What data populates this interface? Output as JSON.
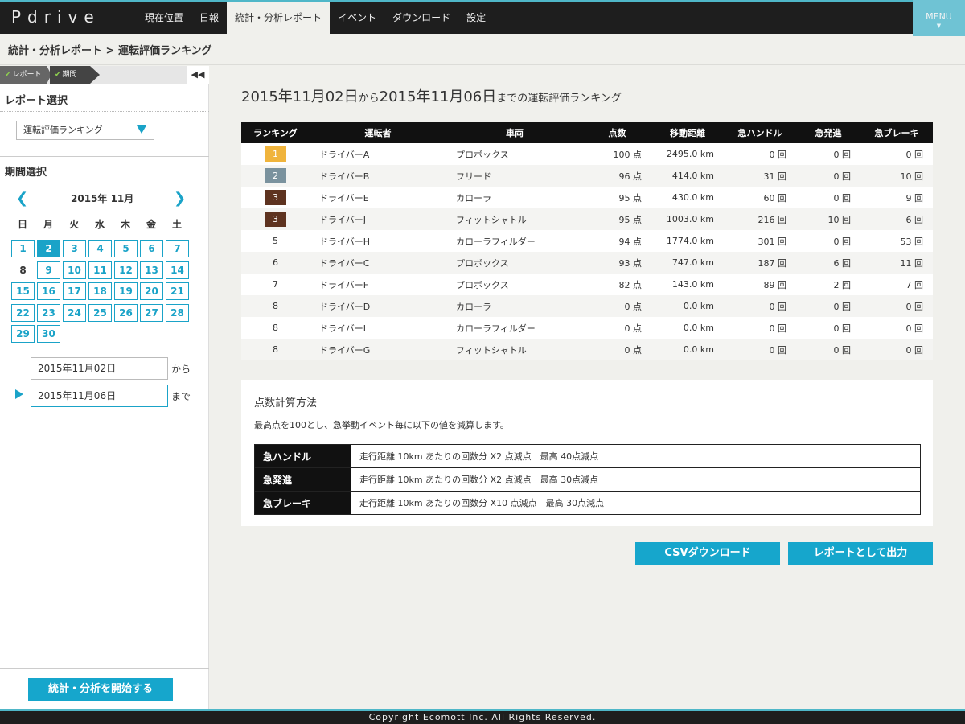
{
  "app": {
    "logo": "Pdrive",
    "menu_label": "MENU",
    "nav": [
      "現在位置",
      "日報",
      "統計・分析レポート",
      "イベント",
      "ダウンロード",
      "設定"
    ]
  },
  "breadcrumb": "統計・分析レポート > 運転評価ランキング",
  "sidebar": {
    "steps": [
      "レポート",
      "期間"
    ],
    "collapse_icon": "◀◀",
    "report_section_title": "レポート選択",
    "report_selected": "運転評価ランキング",
    "period_section_title": "期間選択",
    "calendar": {
      "title": "2015年 11月",
      "prev": "❮",
      "next": "❯",
      "weekdays": [
        "日",
        "月",
        "火",
        "水",
        "木",
        "金",
        "土"
      ],
      "selected_day": 2,
      "today_day": 8
    },
    "from_date": "2015年11月02日",
    "from_suffix": "から",
    "to_date": "2015年11月06日",
    "to_suffix": "まで",
    "start_button": "統計・分析を開始する"
  },
  "main": {
    "title_from": "2015年11月02日",
    "title_mid": "から",
    "title_to": "2015年11月06日",
    "title_end": "までの運転評価ランキング",
    "table": {
      "headers": [
        "ランキング",
        "運転者",
        "車両",
        "点数",
        "移動距離",
        "急ハンドル",
        "急発進",
        "急ブレーキ"
      ],
      "rows": [
        {
          "rank": "1",
          "driver": "ドライバーA",
          "car": "プロボックス",
          "score": "100 点",
          "distance": "2495.0 km",
          "handle": "0 回",
          "start": "0 回",
          "brake": "0 回"
        },
        {
          "rank": "2",
          "driver": "ドライバーB",
          "car": "フリード",
          "score": "96 点",
          "distance": "414.0 km",
          "handle": "31 回",
          "start": "0 回",
          "brake": "10 回"
        },
        {
          "rank": "3",
          "driver": "ドライバーE",
          "car": "カローラ",
          "score": "95 点",
          "distance": "430.0 km",
          "handle": "60 回",
          "start": "0 回",
          "brake": "9 回"
        },
        {
          "rank": "3",
          "driver": "ドライバーJ",
          "car": "フィットシャトル",
          "score": "95 点",
          "distance": "1003.0 km",
          "handle": "216 回",
          "start": "10 回",
          "brake": "6 回"
        },
        {
          "rank": "5",
          "driver": "ドライバーH",
          "car": "カローラフィルダー",
          "score": "94 点",
          "distance": "1774.0 km",
          "handle": "301 回",
          "start": "0 回",
          "brake": "53 回"
        },
        {
          "rank": "6",
          "driver": "ドライバーC",
          "car": "プロボックス",
          "score": "93 点",
          "distance": "747.0 km",
          "handle": "187 回",
          "start": "6 回",
          "brake": "11 回"
        },
        {
          "rank": "7",
          "driver": "ドライバーF",
          "car": "プロボックス",
          "score": "82 点",
          "distance": "143.0 km",
          "handle": "89 回",
          "start": "2 回",
          "brake": "7 回"
        },
        {
          "rank": "8",
          "driver": "ドライバーD",
          "car": "カローラ",
          "score": "0 点",
          "distance": "0.0 km",
          "handle": "0 回",
          "start": "0 回",
          "brake": "0 回"
        },
        {
          "rank": "8",
          "driver": "ドライバーI",
          "car": "カローラフィルダー",
          "score": "0 点",
          "distance": "0.0 km",
          "handle": "0 回",
          "start": "0 回",
          "brake": "0 回"
        },
        {
          "rank": "8",
          "driver": "ドライバーG",
          "car": "フィットシャトル",
          "score": "0 点",
          "distance": "0.0 km",
          "handle": "0 回",
          "start": "0 回",
          "brake": "0 回"
        }
      ]
    },
    "calc": {
      "title": "点数計算方法",
      "desc": "最高点を100とし、急挙動イベント毎に以下の値を減算します。",
      "rules": [
        {
          "name": "急ハンドル",
          "text": "走行距離 10km あたりの回数分 X2 点減点　最高 40点減点"
        },
        {
          "name": "急発進",
          "text": "走行距離 10km あたりの回数分 X2 点減点　最高 30点減点"
        },
        {
          "name": "急ブレーキ",
          "text": "走行距離 10km あたりの回数分 X10 点減点　最高 30点減点"
        }
      ]
    },
    "csv_button": "CSVダウンロード",
    "report_button": "レポートとして出力"
  },
  "footer": "Copyright Ecomott Inc. All Rights Reserved.",
  "colors": {
    "accent": "#16a6cc",
    "gold": "#f0b43c",
    "silver": "#7a929e",
    "bronze": "#5e3320"
  }
}
